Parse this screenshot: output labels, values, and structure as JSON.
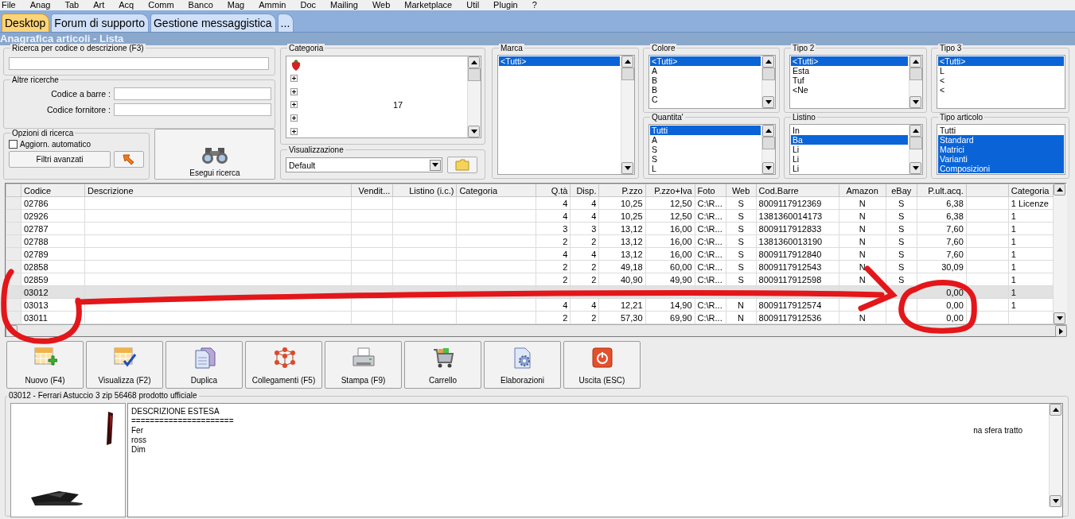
{
  "menu": [
    "File",
    "Anag",
    "Tab",
    "Art",
    "Acq",
    "Comm",
    "Banco",
    "Mag",
    "Ammin",
    "Doc",
    "Mailing",
    "Web",
    "Marketplace",
    "Util",
    "Plugin",
    "?"
  ],
  "tabs": [
    {
      "label": "Desktop",
      "selected": true
    },
    {
      "label": "Forum di supporto",
      "selected": false
    },
    {
      "label": "Gestione messaggistica",
      "selected": false
    },
    {
      "label": "...",
      "selected": false
    }
  ],
  "panel_title": "Anagrafica articoli  - Lista",
  "search": {
    "title": "Ricerca per codice o descrizione (F3)"
  },
  "other_searches": {
    "title": "Altre ricerche",
    "fields": [
      {
        "label": "Codice a barre :"
      },
      {
        "label": "Codice fornitore :"
      }
    ]
  },
  "options": {
    "title": "Opzioni di ricerca",
    "auto_update": {
      "label": "Aggiorn. automatico",
      "checked": false
    },
    "advanced_button": "Filtri avanzati"
  },
  "search_button": "Esegui ricerca",
  "category": {
    "title": "Categoria",
    "items": [
      {
        "kind": "root"
      },
      {
        "kind": "node",
        "expanded": false
      },
      {
        "kind": "node",
        "expanded": false
      },
      {
        "kind": "node",
        "expanded": false,
        "label": "17"
      },
      {
        "kind": "node",
        "expanded": false
      },
      {
        "kind": "node",
        "expanded": false
      }
    ]
  },
  "view": {
    "title": "Visualizzazione",
    "value": "Default"
  },
  "filters": [
    {
      "title": "Marca",
      "scroll": true,
      "items": [
        {
          "label": "<Tutti>",
          "selected": true
        }
      ]
    },
    {
      "title": "Colore",
      "scroll": true,
      "items": [
        {
          "label": "<Tutti>",
          "selected": true
        },
        {
          "label": "A",
          "selected": false
        },
        {
          "label": "B",
          "selected": false
        },
        {
          "label": "B",
          "selected": false
        },
        {
          "label": "C",
          "selected": false
        }
      ]
    },
    {
      "title": "Tipo 2",
      "scroll": true,
      "items": [
        {
          "label": "<Tutti>",
          "selected": true
        },
        {
          "label": "Esta",
          "selected": false
        },
        {
          "label": "Tuf",
          "selected": false
        },
        {
          "label": "<Ne",
          "selected": false
        }
      ]
    },
    {
      "title": "Tipo 3",
      "scroll": false,
      "items": [
        {
          "label": "<Tutti>",
          "selected": true
        },
        {
          "label": "L",
          "selected": false
        },
        {
          "label": "<",
          "selected": false
        },
        {
          "label": "<",
          "selected": false
        }
      ]
    },
    {
      "title": "Quantita'",
      "scroll": true,
      "items": [
        {
          "label": "Tutti",
          "selected": true
        },
        {
          "label": "A",
          "selected": false
        },
        {
          "label": "S",
          "selected": false
        },
        {
          "label": "S",
          "selected": false
        },
        {
          "label": "L",
          "selected": false
        }
      ]
    },
    {
      "title": "Listino",
      "scroll": true,
      "items": [
        {
          "label": "In",
          "selected": false
        },
        {
          "label": "Ba",
          "selected": true
        },
        {
          "label": "Li",
          "selected": false
        },
        {
          "label": "Li",
          "selected": false
        },
        {
          "label": "Li",
          "selected": false
        }
      ]
    },
    {
      "title": "Tipo articolo",
      "scroll": false,
      "items": [
        {
          "label": "Tutti",
          "selected": false
        },
        {
          "label": "Standard",
          "selected": true
        },
        {
          "label": "Matrici",
          "selected": true
        },
        {
          "label": "Varianti",
          "selected": true
        },
        {
          "label": "Composizioni",
          "selected": true
        }
      ]
    }
  ],
  "grid": {
    "columns": [
      "Codice",
      "Descrizione",
      "Vendit...",
      "Listino (i.c.)",
      "Categoria",
      "Q.tà",
      "Disp.",
      "P.zzo",
      "P.zzo+Iva",
      "Foto",
      "Web",
      "Cod.Barre",
      "Amazon",
      "eBay",
      "P.ult.acq.",
      null,
      "Categoria"
    ],
    "rows": [
      {
        "selected": false,
        "cells": [
          "02786",
          null,
          null,
          null,
          null,
          "4",
          "4",
          "10,25",
          "12,50",
          "C:\\R...",
          "S",
          "8009117912369",
          "N",
          "S",
          "6,38",
          null,
          "1 Licenze"
        ]
      },
      {
        "selected": false,
        "cells": [
          "02926",
          null,
          null,
          null,
          null,
          "4",
          "4",
          "10,25",
          "12,50",
          "C:\\R...",
          "S",
          "1381360014173",
          "N",
          "S",
          "6,38",
          null,
          "1"
        ]
      },
      {
        "selected": false,
        "cells": [
          "02787",
          null,
          null,
          null,
          null,
          "3",
          "3",
          "13,12",
          "16,00",
          "C:\\R...",
          "S",
          "8009117912833",
          "N",
          "S",
          "7,60",
          null,
          "1"
        ]
      },
      {
        "selected": false,
        "cells": [
          "02788",
          null,
          null,
          null,
          null,
          "2",
          "2",
          "13,12",
          "16,00",
          "C:\\R...",
          "S",
          "1381360013190",
          "N",
          "S",
          "7,60",
          null,
          "1"
        ]
      },
      {
        "selected": false,
        "cells": [
          "02789",
          null,
          null,
          null,
          null,
          "4",
          "4",
          "13,12",
          "16,00",
          "C:\\R...",
          "S",
          "8009117912840",
          "N",
          "S",
          "7,60",
          null,
          "1"
        ]
      },
      {
        "selected": false,
        "cells": [
          "02858",
          null,
          null,
          null,
          null,
          "2",
          "2",
          "49,18",
          "60,00",
          "C:\\R...",
          "S",
          "8009117912543",
          "N",
          "S",
          "30,09",
          null,
          "1"
        ]
      },
      {
        "selected": false,
        "cells": [
          "02859",
          null,
          null,
          null,
          null,
          "2",
          "2",
          "40,90",
          "49,90",
          "C:\\R...",
          "S",
          "8009117912598",
          "N",
          "S",
          null,
          null,
          "1"
        ]
      },
      {
        "selected": true,
        "cells": [
          "03012",
          null,
          null,
          null,
          null,
          null,
          null,
          null,
          null,
          null,
          null,
          null,
          null,
          null,
          "0,00",
          null,
          "1"
        ]
      },
      {
        "selected": false,
        "cells": [
          "03013",
          null,
          null,
          null,
          null,
          "4",
          "4",
          "12,21",
          "14,90",
          "C:\\R...",
          "N",
          "8009117912574",
          null,
          null,
          "0,00",
          null,
          "1"
        ]
      },
      {
        "selected": false,
        "cells": [
          "03011",
          null,
          null,
          null,
          null,
          "2",
          "2",
          "57,30",
          "69,90",
          "C:\\R...",
          "N",
          "8009117912536",
          "N",
          null,
          "0,00",
          null,
          null
        ]
      }
    ]
  },
  "toolbar": [
    "Nuovo (F4)",
    "Visualizza (F2)",
    "Duplica",
    "Collegamenti (F5)",
    "Stampa (F9)",
    "Carrello",
    "Elaborazioni",
    "Uscita (ESC)"
  ],
  "detail": {
    "title": "03012 - Ferrari Astuccio 3 zip 56468 prodotto ufficiale",
    "picture": {
      "kind": "picture"
    },
    "lines": [
      "DESCRIZIONE ESTESA",
      "======================",
      "Fer",
      "ross",
      "Dim"
    ],
    "side_text": "na sfera tratto"
  }
}
